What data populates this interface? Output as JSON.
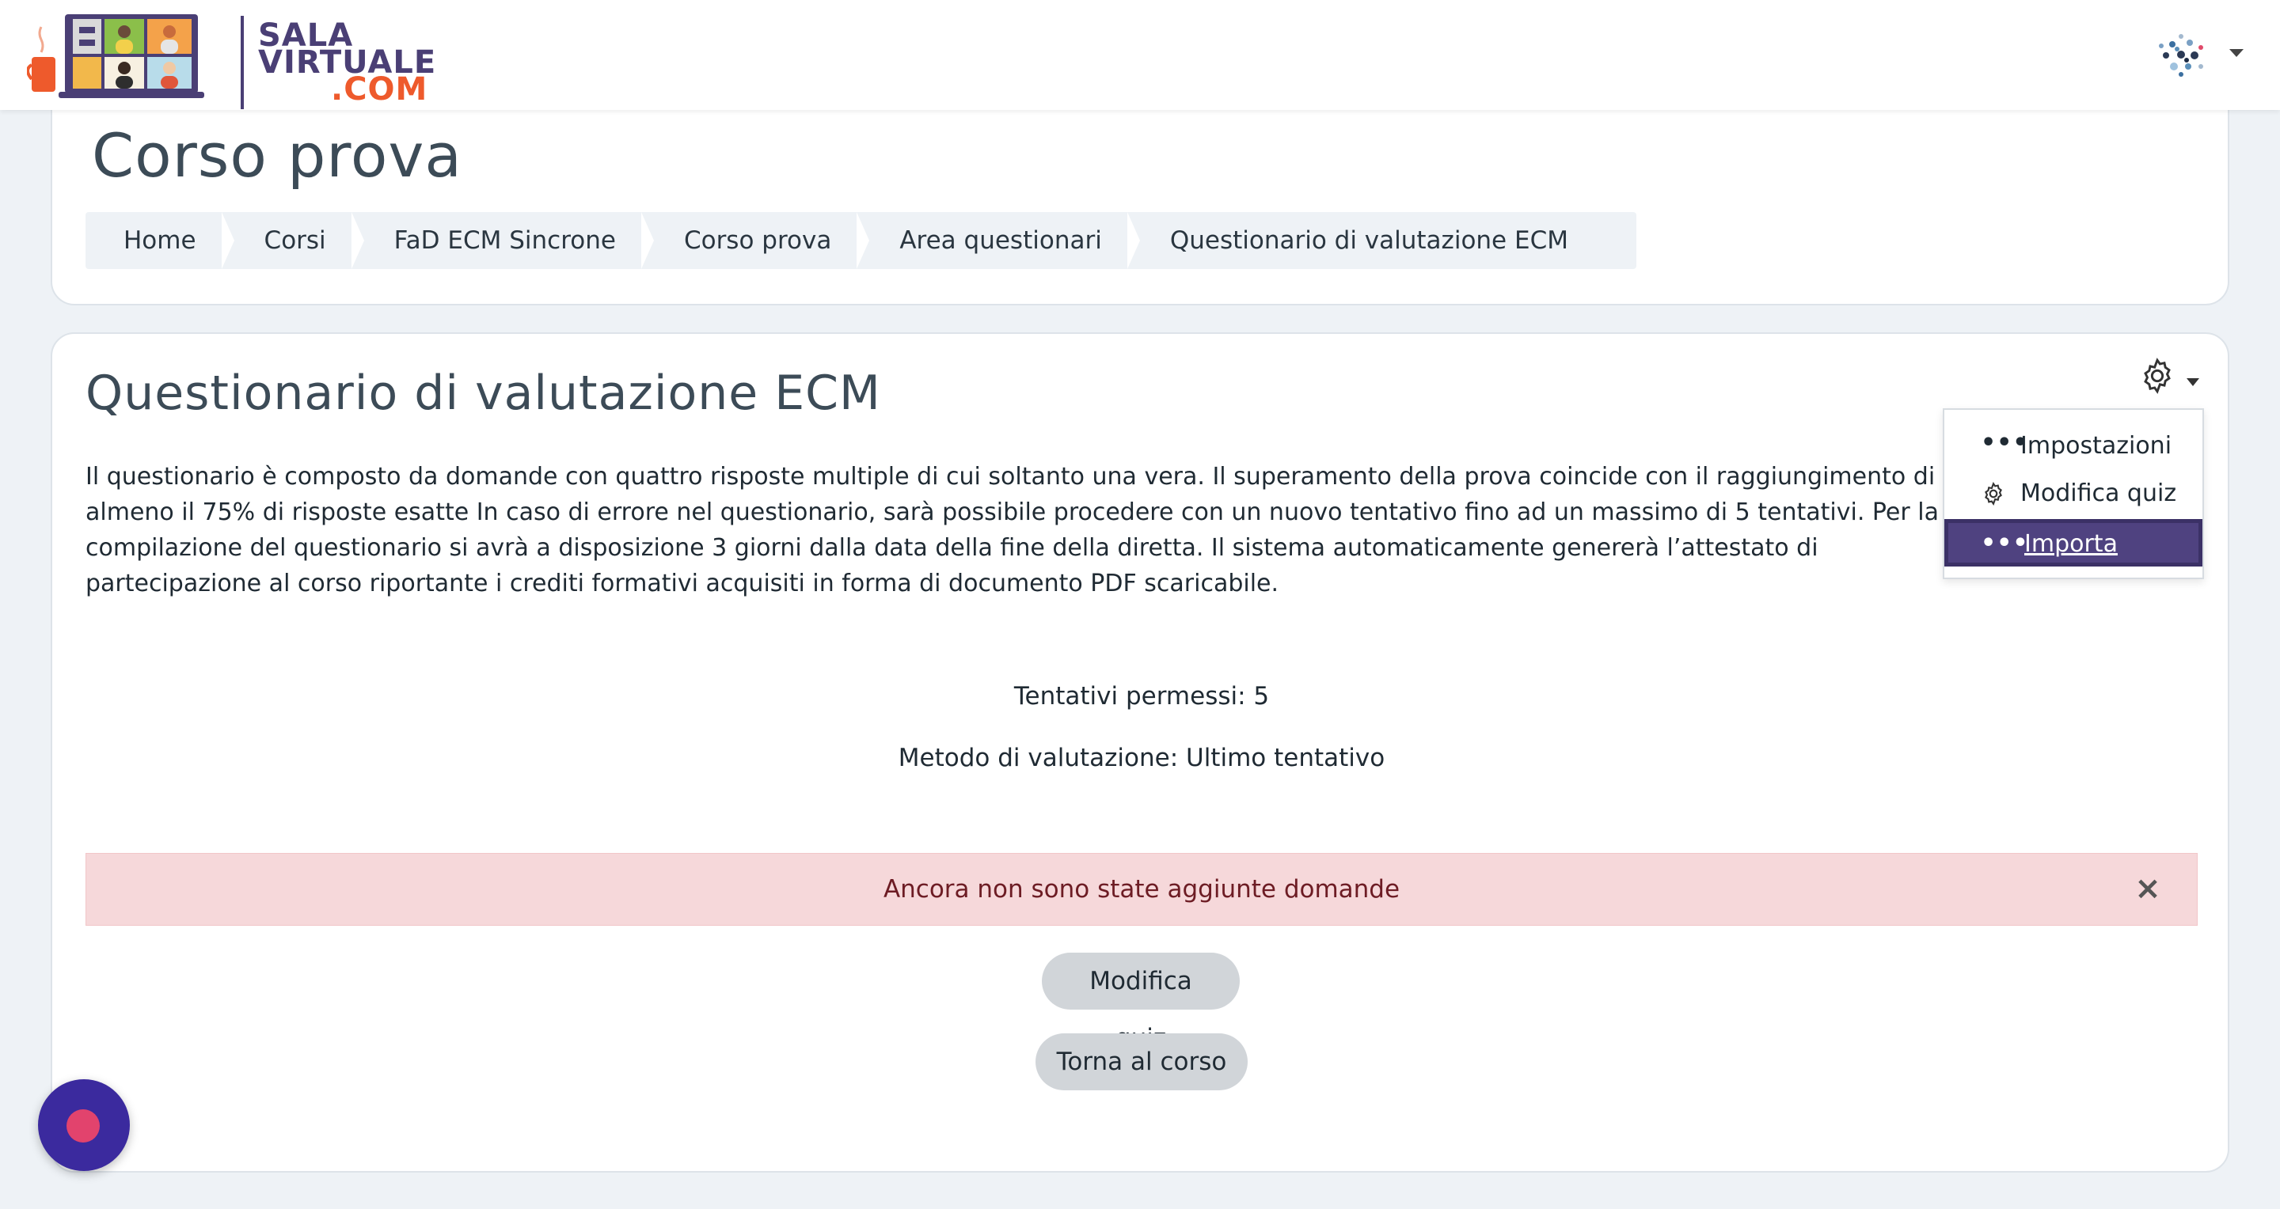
{
  "brand": {
    "line1": "SALA",
    "line2": "VIRTUALE",
    "line3": ".COM",
    "primary_color": "#4a3f75",
    "accent_color": "#ee5a2c"
  },
  "page": {
    "title": "Corso prova"
  },
  "breadcrumb": [
    {
      "label": "Home"
    },
    {
      "label": "Corsi"
    },
    {
      "label": "FaD ECM Sincrone"
    },
    {
      "label": "Corso prova"
    },
    {
      "label": "Area questionari"
    },
    {
      "label": "Questionario di valutazione ECM"
    }
  ],
  "quiz": {
    "title": "Questionario di valutazione ECM",
    "intro": "Il questionario è composto da domande con quattro risposte multiple di cui soltanto una vera. Il superamento della prova coincide con il raggiungimento di almeno il 75% di risposte esatte In caso di errore nel questionario, sarà possibile procedere con un nuovo tentativo fino ad un massimo di 5 tentativi. Per la compilazione del questionario si avrà a disposizione 3 giorni dalla data della fine della diretta. Il sistema automaticamente genererà l’attestato di partecipazione al corso riportante i crediti formativi acquisiti in forma di documento PDF scaricabile.",
    "attempts": "Tentativi permessi: 5",
    "grading": "Metodo di valutazione: Ultimo tentativo",
    "alert": "Ancora non sono state aggiunte domande",
    "alert_close": "×",
    "edit_button": "Modifica quiz",
    "back_button": "Torna al corso"
  },
  "actions_menu": {
    "items": [
      {
        "label": "Impostazioni",
        "icon": "dots-icon"
      },
      {
        "label": "Modifica quiz",
        "icon": "gear-icon"
      },
      {
        "label": "Importa",
        "icon": "dots-icon",
        "active": true
      }
    ],
    "active_color": "#4f4280"
  },
  "alert_color": "#f6d8da"
}
